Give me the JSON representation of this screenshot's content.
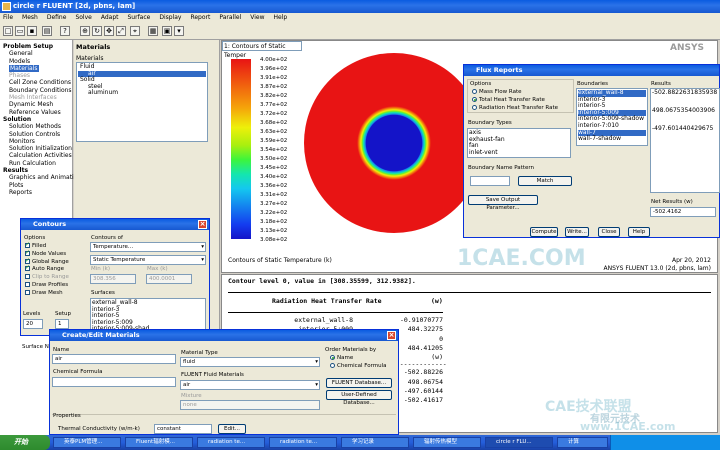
{
  "app": {
    "title": "circle r FLUENT  [2d, pbns, lam]"
  },
  "menu": [
    "File",
    "Mesh",
    "Define",
    "Solve",
    "Adapt",
    "Surface",
    "Display",
    "Report",
    "Parallel",
    "View",
    "Help"
  ],
  "nav": {
    "sections": [
      {
        "label": "Problem Setup",
        "items": [
          {
            "label": "General"
          },
          {
            "label": "Models"
          },
          {
            "label": "Materials",
            "selected": true
          },
          {
            "label": "Phases",
            "disabled": true
          },
          {
            "label": "Cell Zone Conditions"
          },
          {
            "label": "Boundary Conditions"
          },
          {
            "label": "Mesh Interfaces",
            "disabled": true
          },
          {
            "label": "Dynamic Mesh"
          },
          {
            "label": "Reference Values"
          }
        ]
      },
      {
        "label": "Solution",
        "items": [
          {
            "label": "Solution Methods"
          },
          {
            "label": "Solution Controls"
          },
          {
            "label": "Monitors"
          },
          {
            "label": "Solution Initialization"
          },
          {
            "label": "Calculation Activities"
          },
          {
            "label": "Run Calculation"
          }
        ]
      },
      {
        "label": "Results",
        "items": [
          {
            "label": "Graphics and Animations"
          },
          {
            "label": "Plots"
          },
          {
            "label": "Reports"
          }
        ]
      }
    ]
  },
  "materials_panel": {
    "heading": "Materials",
    "label": "Materials",
    "tree": [
      {
        "label": "Fluid",
        "indent": 0
      },
      {
        "label": "air",
        "indent": 1,
        "selected": true
      },
      {
        "label": "Solid",
        "indent": 0
      },
      {
        "label": "steel",
        "indent": 1
      },
      {
        "label": "aluminum",
        "indent": 1
      }
    ]
  },
  "graphics": {
    "tab": "1: Contours of Static Temper",
    "logo": "ANSYS",
    "colorbar_labels": [
      "4.00e+02",
      "3.96e+02",
      "3.91e+02",
      "3.87e+02",
      "3.82e+02",
      "3.77e+02",
      "3.72e+02",
      "3.68e+02",
      "3.63e+02",
      "3.59e+02",
      "3.54e+02",
      "3.50e+02",
      "3.45e+02",
      "3.40e+02",
      "3.36e+02",
      "3.31e+02",
      "3.27e+02",
      "3.22e+02",
      "3.18e+02",
      "3.13e+02",
      "3.08e+02"
    ],
    "caption": "Contours of Static Temperature (k)",
    "date": "Apr 20, 2012",
    "version": "ANSYS FLUENT 13.0 (2d, pbns, lam)",
    "watermark": "1CAE.COM"
  },
  "console": {
    "line1": "Contour level 0, value in [308.35599, 312.9382].",
    "header_left": "Radiation Heat Transfer Rate",
    "header_right": "(w)",
    "rows": [
      {
        "name": "external_wall-8",
        "value": "-0.91070777"
      },
      {
        "name": "interior-5:009",
        "value": "484.32275"
      },
      {
        "name": "",
        "value": "0"
      },
      {
        "name": "",
        "value": "484.41205"
      },
      {
        "name": "",
        "value": "(w)"
      },
      {
        "name": "",
        "value": "-502.88226"
      },
      {
        "name": "",
        "value": "498.06754"
      },
      {
        "name": "",
        "value": "-497.60144"
      },
      {
        "name": "",
        "value": "-502.41617"
      }
    ],
    "separator": "---------------"
  },
  "flux": {
    "title": "Flux Reports",
    "options_label": "Options",
    "options": [
      {
        "label": "Mass Flow Rate",
        "selected": false
      },
      {
        "label": "Total Heat Transfer Rate",
        "selected": true
      },
      {
        "label": "Radiation Heat Transfer Rate",
        "selected": false
      }
    ],
    "boundary_types_label": "Boundary Types",
    "boundary_types": [
      "axis",
      "exhaust-fan",
      "fan",
      "inlet-vent"
    ],
    "pattern_label": "Boundary Name Pattern",
    "pattern_value": "",
    "match_button": "Match",
    "save_button": "Save Output Parameter...",
    "boundaries_label": "Boundaries",
    "boundaries": [
      {
        "label": "external_wall-8",
        "selected": true
      },
      {
        "label": "interior-3",
        "selected": false
      },
      {
        "label": "interior-5",
        "selected": false
      },
      {
        "label": "interior-5:009",
        "selected": true
      },
      {
        "label": "interior-5:009-shadow",
        "selected": false
      },
      {
        "label": "interior-7:010",
        "selected": false
      },
      {
        "label": "wall-7",
        "selected": true
      },
      {
        "label": "wall-7-shadow",
        "selected": false
      }
    ],
    "results_label": "Results",
    "results": [
      "-502.8822631835938",
      "498.0675354003906",
      "-497.601440429675"
    ],
    "net_label": "Net Results (w)",
    "net_value": "-502.4162",
    "buttons": [
      "Compute",
      "Write...",
      "Close",
      "Help"
    ]
  },
  "contours": {
    "title": "Contours",
    "options_label": "Options",
    "options": [
      {
        "label": "Filled",
        "checked": true
      },
      {
        "label": "Node Values",
        "checked": true
      },
      {
        "label": "Global Range",
        "checked": true
      },
      {
        "label": "Auto Range",
        "checked": true
      },
      {
        "label": "Clip to Range",
        "checked": false,
        "disabled": true
      },
      {
        "label": "Draw Profiles",
        "checked": false
      },
      {
        "label": "Draw Mesh",
        "checked": false
      }
    ],
    "contours_of_label": "Contours of",
    "quantity": "Temperature...",
    "sub_quantity": "Static Temperature",
    "min_label": "Min (k)",
    "max_label": "Max (k)",
    "min_value": "308.356",
    "max_value": "400.0001",
    "surfaces_label": "Surfaces",
    "surfaces": [
      "external_wall-8",
      "interior-3",
      "interior-5",
      "interior-5:009",
      "interior-5:009-shad"
    ],
    "levels_label": "Levels",
    "levels_value": "20",
    "setup_label": "Setup",
    "setup_value": "1",
    "surface_name_label": "Surface Na"
  },
  "material_dialog": {
    "title": "Create/Edit Materials",
    "name_label": "Name",
    "name_value": "air",
    "formula_label": "Chemical Formula",
    "formula_value": "",
    "type_label": "Material Type",
    "type_value": "fluid",
    "fluid_materials_label": "FLUENT Fluid Materials",
    "fluid_materials_value": "air",
    "mixture_label": "Mixture",
    "mixture_value": "none",
    "order_label": "Order Materials by",
    "order_options": [
      {
        "label": "Name",
        "selected": true
      },
      {
        "label": "Chemical Formula",
        "selected": false
      }
    ],
    "db_button": "FLUENT Database...",
    "user_db_button": "User-Defined Database...",
    "properties_label": "Properties",
    "prop_label": "Thermal Conductivity (w/m-k)",
    "prop_method": "constant",
    "prop_edit": "Edit..."
  },
  "taskbar": {
    "start": "开始",
    "tasks": [
      "英泰PLM管理...",
      "Fluent辐射模...",
      "radiation te...",
      "radiation te...",
      "学习记录",
      "辐射传热模型",
      "circle r FLU...",
      "计算"
    ],
    "active_index": 6
  },
  "watermarks": {
    "brand": "CAE技术联盟",
    "site": "www.1CAE.com",
    "big": "有限元技术"
  }
}
